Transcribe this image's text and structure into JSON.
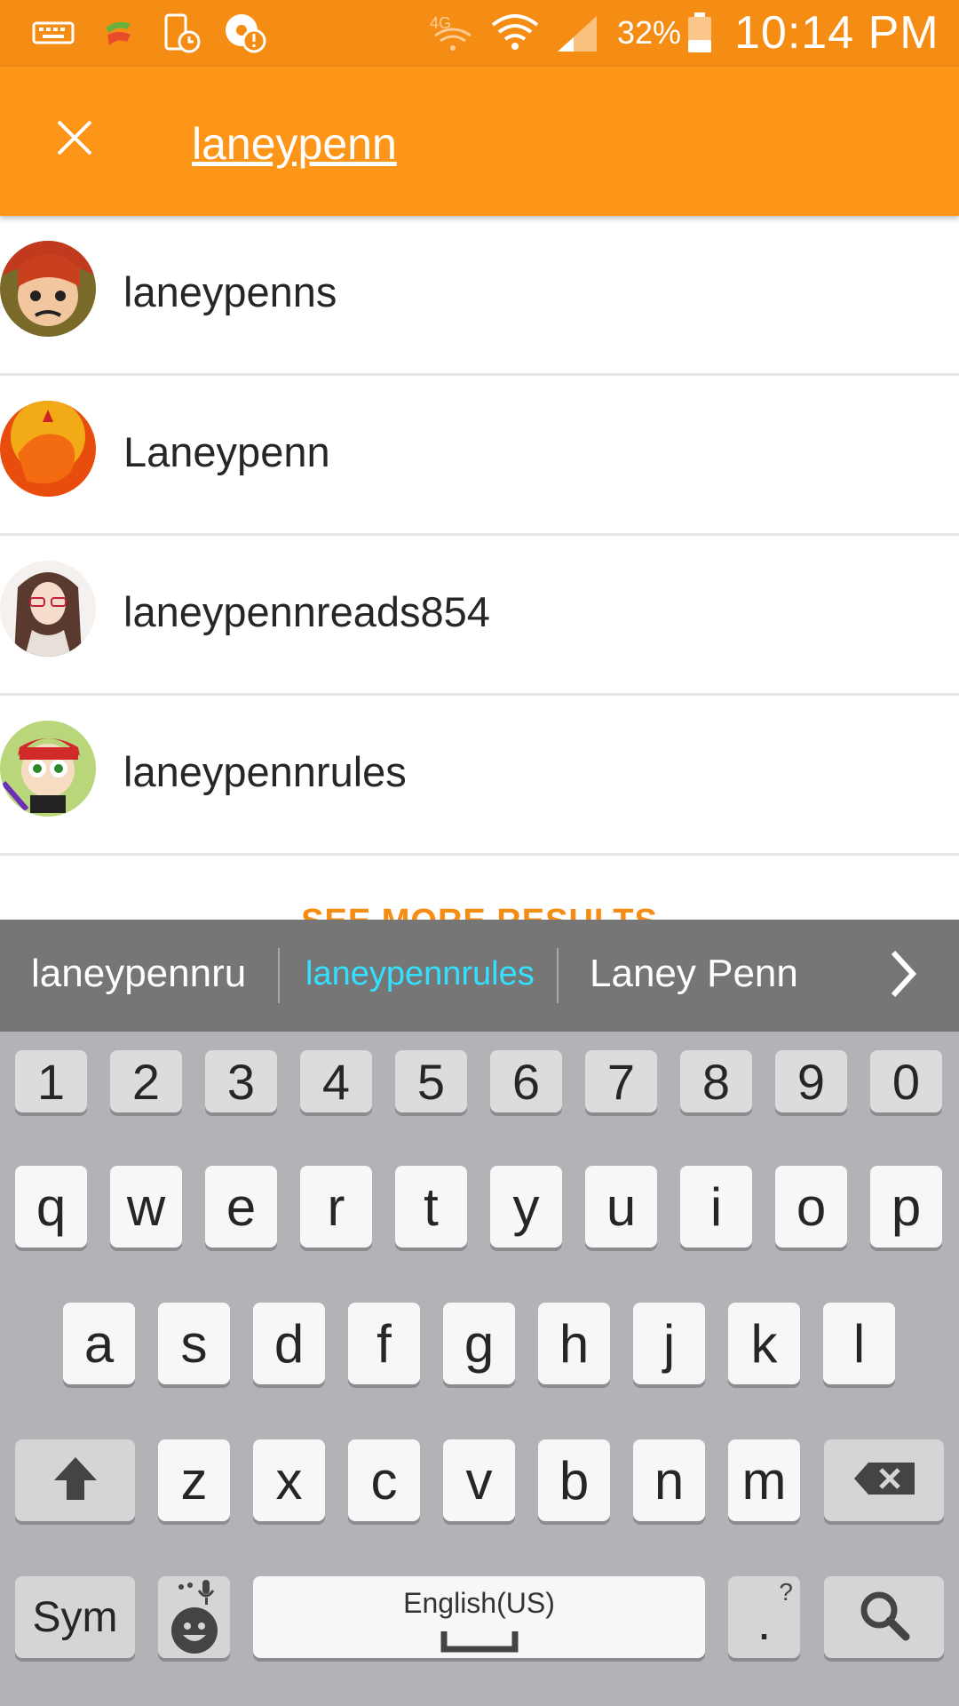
{
  "status_bar": {
    "battery_percent": "32%",
    "time": "10:14 PM",
    "network_label": "4G",
    "icons": [
      "keyboard-icon",
      "app-icon",
      "device-clock-icon",
      "sync-alert-icon",
      "network-4g-icon",
      "wifi-icon",
      "signal-icon",
      "battery-icon"
    ]
  },
  "search": {
    "query": "laneypenn"
  },
  "results": [
    {
      "username": "laneypenns"
    },
    {
      "username": "Laneypenn"
    },
    {
      "username": "laneypennreads854"
    },
    {
      "username": "laneypennrules"
    }
  ],
  "see_more_label": "SEE MORE RESULTS",
  "suggestions": {
    "items": [
      "laneypennru",
      "laneypennrules",
      "Laney Penn"
    ],
    "highlight_color": "#33e0ff"
  },
  "keyboard": {
    "numbers": [
      "1",
      "2",
      "3",
      "4",
      "5",
      "6",
      "7",
      "8",
      "9",
      "0"
    ],
    "row1": [
      "q",
      "w",
      "e",
      "r",
      "t",
      "y",
      "u",
      "i",
      "o",
      "p"
    ],
    "row2": [
      "a",
      "s",
      "d",
      "f",
      "g",
      "h",
      "j",
      "k",
      "l"
    ],
    "row3": [
      "z",
      "x",
      "c",
      "v",
      "b",
      "n",
      "m"
    ],
    "sym_label": "Sym",
    "language_label": "English(US)",
    "period_label": ".",
    "period_hint": "?"
  },
  "colors": {
    "header": "#fd9618",
    "status_bar": "#f58d15",
    "accent": "#f58d15"
  }
}
